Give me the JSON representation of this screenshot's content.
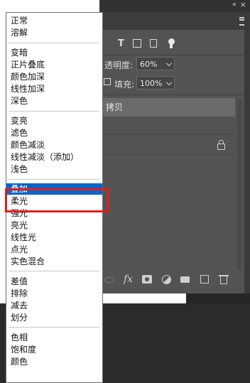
{
  "blend_menu": {
    "groups": [
      [
        "正常",
        "溶解"
      ],
      [
        "变暗",
        "正片叠底",
        "颜色加深",
        "线性加深",
        "深色"
      ],
      [
        "变亮",
        "滤色",
        "颜色减淡",
        "线性减淡（添加）",
        "浅色"
      ],
      [
        "叠加",
        "柔光",
        "强光",
        "亮光",
        "线性光",
        "点光",
        "实色混合"
      ],
      [
        "差值",
        "排除",
        "减去",
        "划分"
      ],
      [
        "色相",
        "饱和度",
        "颜色"
      ]
    ],
    "selected": "叠加"
  },
  "layers_panel": {
    "collapse_glyph": "«",
    "close_glyph": "×",
    "filter_icons": [
      "type-filter-icon",
      "shape-filter-icon",
      "smart-object-filter-icon",
      "filter-toggle-icon"
    ],
    "type_glyph": "T",
    "opacity_label": "透明度:",
    "opacity_value": "60%",
    "fill_label": "填充:",
    "fill_value": "100%",
    "selected_layer_name": "拷贝",
    "bottom_icons": [
      "link-layers-icon",
      "fx-icon",
      "add-mask-icon",
      "adjustment-icon",
      "new-group-icon",
      "new-layer-icon",
      "delete-layer-icon"
    ],
    "fx_glyph": "fx"
  },
  "colors": {
    "selection": "#0a64c8",
    "highlight_box": "#e01e1e",
    "panel_bg": "#535353"
  }
}
